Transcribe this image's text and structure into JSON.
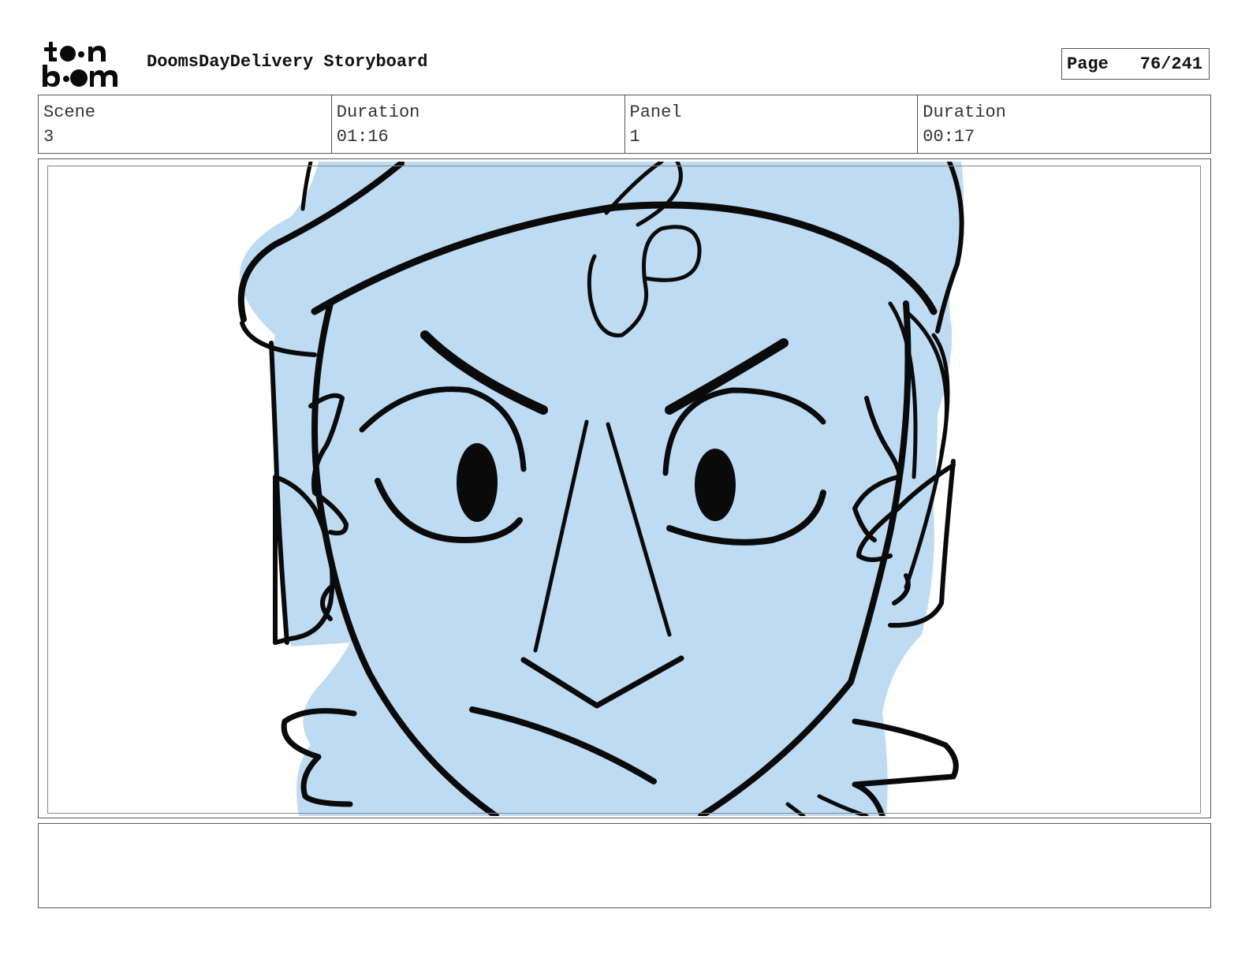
{
  "header": {
    "logo_text": "toon boom",
    "document_title": "DoomsDayDelivery Storyboard",
    "page_label": "Page",
    "page_number": "76/241"
  },
  "info": {
    "scene_label": "Scene",
    "scene_value": "3",
    "scene_duration_label": "Duration",
    "scene_duration_value": "01:16",
    "panel_label": "Panel",
    "panel_value": "1",
    "panel_duration_label": "Duration",
    "panel_duration_value": "00:17"
  },
  "panel": {
    "fill_color": "#bddbf3",
    "line_color": "#0a0a0a"
  },
  "notes": {
    "text": ""
  }
}
